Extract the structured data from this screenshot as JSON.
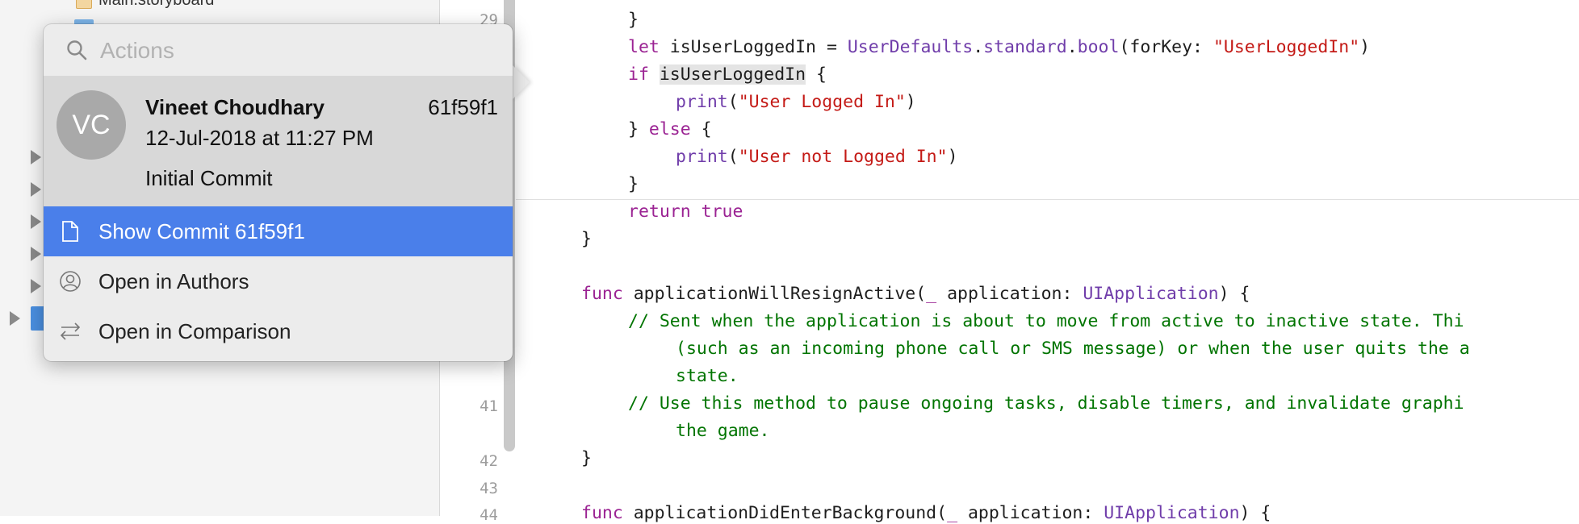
{
  "navigator": {
    "top_item_label": "Main.storyboard"
  },
  "gutter": {
    "line_numbers": [
      "29",
      "41",
      "42",
      "43",
      "44"
    ]
  },
  "code": {
    "line_29": "    }",
    "line_let_kw": "let",
    "line_let_var": " isUserLoggedIn = ",
    "line_let_type": "UserDefaults",
    "line_let_dot1": ".",
    "line_let_prop": "standard",
    "line_let_dot2": ".",
    "line_let_func": "bool",
    "line_let_args": "(forKey: ",
    "line_let_str": "\"UserLoggedIn\"",
    "line_let_close": ")",
    "if_kw": "if",
    "if_var": "isUserLoggedIn",
    "if_brace": " {",
    "print1_func": "print",
    "print1_open": "(",
    "print1_str": "\"User Logged In\"",
    "print1_close": ")",
    "else_open": "} ",
    "else_kw": "else",
    "else_brace": " {",
    "print2_func": "print",
    "print2_open": "(",
    "print2_str": "\"User not Logged In\"",
    "print2_close": ")",
    "if_close": "}",
    "return_kw": "return",
    "return_val": "true",
    "func_close": "}",
    "func_kw": "func",
    "func_name": " applicationWillResignActive(",
    "func_underscore": "_",
    "func_param": " application: ",
    "func_type": "UIApplication",
    "func_rest": ") {",
    "comment1": "// Sent when the application is about to move from active to inactive state. Thi",
    "comment1_cont": "(such as an incoming phone call or SMS message) or when the user quits the a",
    "comment1_cont2": "state.",
    "comment2": "// Use this method to pause ongoing tasks, disable timers, and invalidate graphi",
    "comment2_cont": "the game.",
    "func_close2": "}",
    "func2_kw": "func",
    "func2_name": " applicationDidEnterBackground(",
    "func2_underscore": "_",
    "func2_param": " application: ",
    "func2_type": "UIApplication",
    "func2_rest": ") {"
  },
  "popover": {
    "search": {
      "placeholder": "Actions",
      "value": ""
    },
    "commit": {
      "avatar_initials": "VC",
      "author": "Vineet Choudhary",
      "hash": "61f59f1",
      "date": "12-Jul-2018 at 11:27 PM",
      "message": "Initial Commit"
    },
    "menu": [
      {
        "label": "Show Commit 61f59f1",
        "icon": "document-icon",
        "selected": true
      },
      {
        "label": "Open in Authors",
        "icon": "person-circle-icon",
        "selected": false
      },
      {
        "label": "Open in Comparison",
        "icon": "compare-arrows-icon",
        "selected": false
      }
    ]
  },
  "colors": {
    "selection": "#4a7fea",
    "keyword": "#9b2393",
    "string": "#c41a16",
    "comment": "#007400",
    "type": "#703daa"
  }
}
